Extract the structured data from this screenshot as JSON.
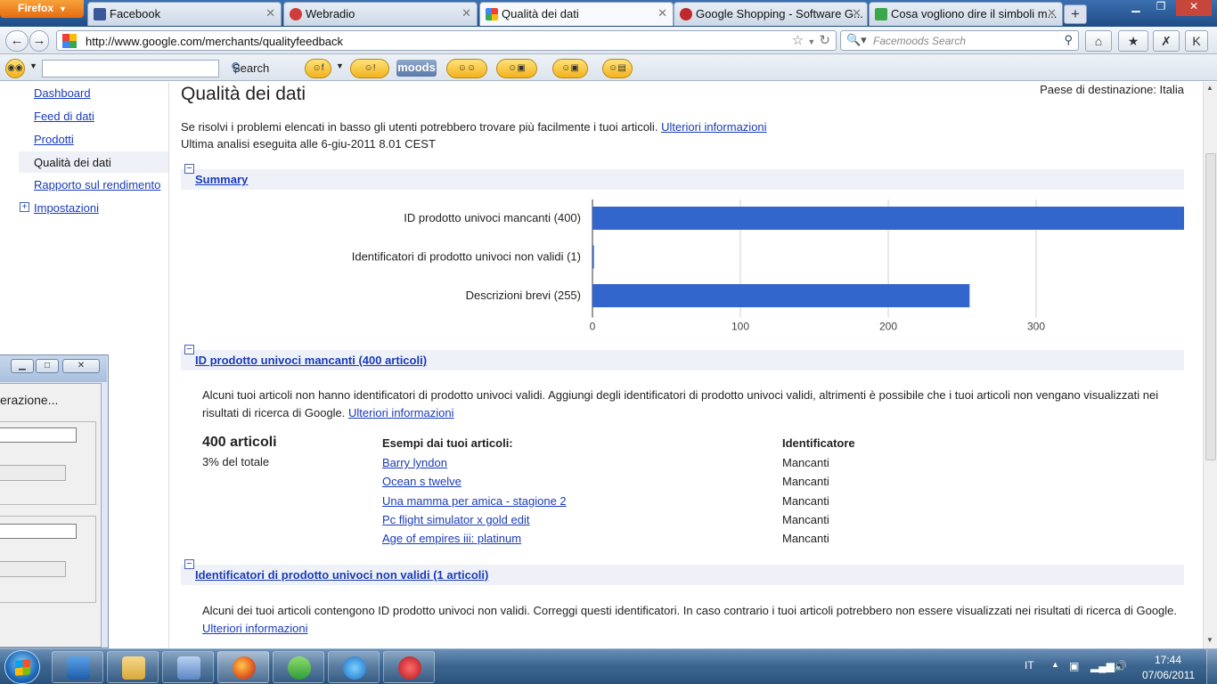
{
  "browser": {
    "app_button": "Firefox",
    "tabs": [
      {
        "label": "Facebook",
        "color": "#3b5998"
      },
      {
        "label": "Webradio",
        "color": "#d23b3b"
      },
      {
        "label": "Qualità dei dati",
        "color": "#4285f4"
      },
      {
        "label": "Google Shopping - Software G...",
        "color": "#c0282d"
      },
      {
        "label": "Cosa vogliono dire il simboli m...",
        "color": "#3aa84a"
      }
    ],
    "url": "http://www.google.com/merchants/qualityfeedback",
    "search_placeholder": "Facemoods Search",
    "toolbar_search_label": "Search",
    "moods_label": "moods"
  },
  "sidebar": {
    "items": [
      {
        "label": "Dashboard"
      },
      {
        "label": "Feed di dati"
      },
      {
        "label": "Prodotti"
      },
      {
        "label": "Qualità dei dati"
      },
      {
        "label": "Rapporto sul rendimento"
      },
      {
        "label": "Impostazioni"
      }
    ]
  },
  "main": {
    "title": "Qualità dei dati",
    "country": "Paese di destinazione: Italia",
    "intro_text": "Se risolvi i problemi elencati in basso gli utenti potrebbero trovare più facilmente i tuoi articoli.",
    "intro_link": "Ulteriori informazioni",
    "last_analysis": "Ultima analisi eseguita alle 6-giu-2011 8.01 CEST",
    "summary": {
      "title": "Summary"
    },
    "section1": {
      "title": "ID prodotto univoci mancanti (400 articoli)",
      "description": "Alcuni tuoi articoli non hanno identificatori di prodotto univoci validi. Aggiungi degli identificatori di prodotto univoci validi, altrimenti è possibile che i tuoi articoli non vengano visualizzati nei risultati di ricerca di Google.",
      "link": "Ulteriori informazioni",
      "count": "400 articoli",
      "percent": "3% del totale",
      "examples_header": "Esempi dai tuoi articoli:",
      "id_header": "Identificatore",
      "rows": [
        {
          "name": "Barry lyndon",
          "id": "Mancanti"
        },
        {
          "name": "Ocean s twelve",
          "id": "Mancanti"
        },
        {
          "name": "Una mamma per amica - stagione 2",
          "id": "Mancanti"
        },
        {
          "name": "Pc flight simulator x gold edit",
          "id": "Mancanti"
        },
        {
          "name": "Age of empires iii: platinum",
          "id": "Mancanti"
        }
      ]
    },
    "section2": {
      "title": "Identificatori di prodotto univoci non validi (1 articoli)",
      "description": "Alcuni dei tuoi articoli contengono ID prodotto univoci non validi. Correggi questi identificatori. In caso contrario i tuoi articoli potrebbero non essere visualizzati nei risultati di ricerca di Google.",
      "link": "Ulteriori informazioni"
    }
  },
  "chart_data": {
    "type": "bar",
    "orientation": "horizontal",
    "categories": [
      "ID prodotto univoci mancanti (400)",
      "Identificatori di prodotto univoci non validi (1)",
      "Descrizioni brevi (255)"
    ],
    "values": [
      400,
      1,
      255
    ],
    "xlim": [
      0,
      400
    ],
    "x_ticks": [
      "0",
      "100",
      "200",
      "300"
    ],
    "grid": true,
    "bar_color": "#3366cc"
  },
  "dialog": {
    "text": "erazione..."
  },
  "taskbar": {
    "language": "IT",
    "time": "17:44",
    "date": "07/06/2011"
  }
}
